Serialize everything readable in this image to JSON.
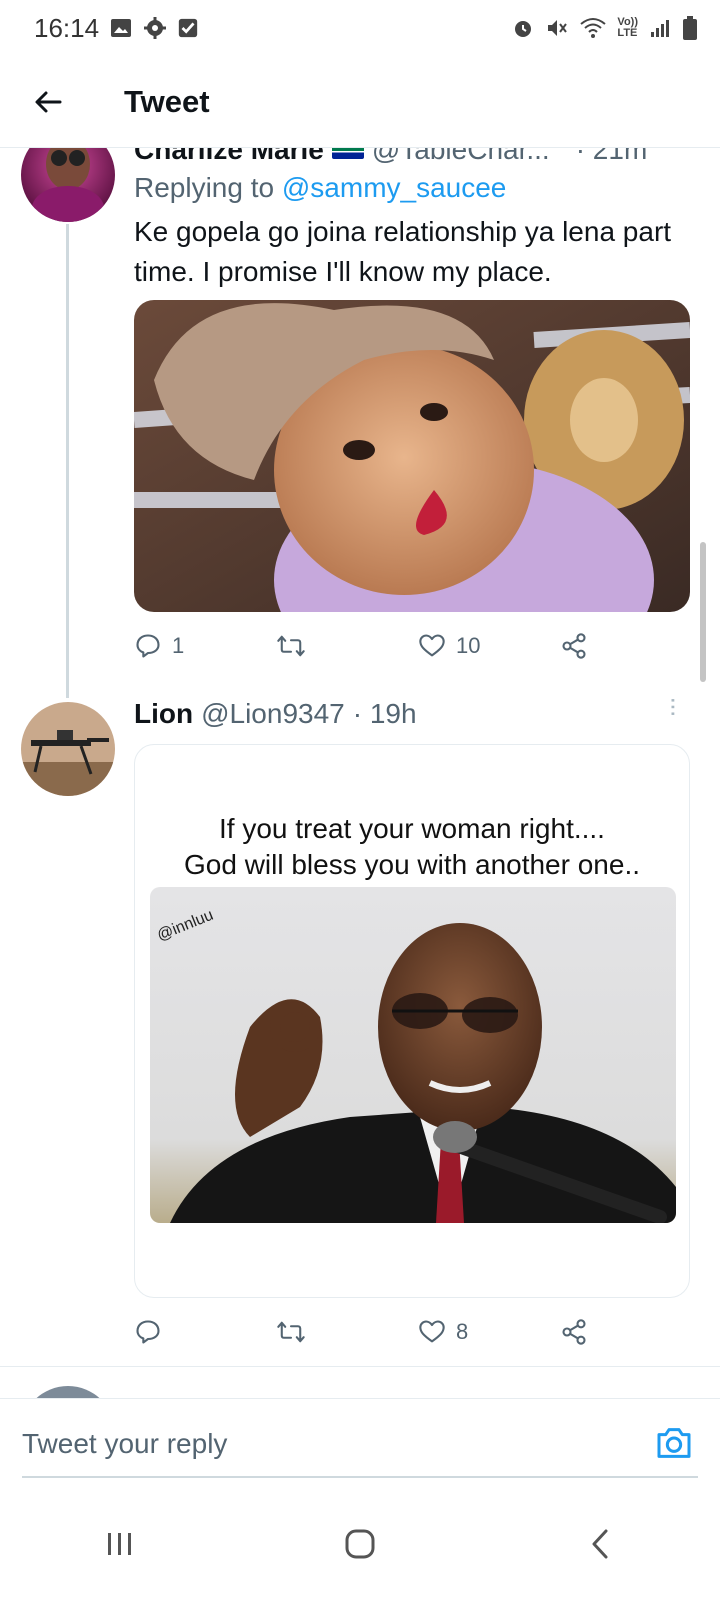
{
  "status_bar": {
    "time": "16:14",
    "left_icons": [
      "gallery-icon",
      "gear-icon",
      "checkbox-icon"
    ],
    "right_icons": [
      "alarm-icon",
      "mute-icon",
      "wifi-icon",
      "volte-icon",
      "signal-icon",
      "battery-icon"
    ],
    "volte_top": "Vo))",
    "volte_bottom": "LTE"
  },
  "header": {
    "title": "Tweet",
    "back_icon": "arrow-left-icon"
  },
  "tweets": [
    {
      "display_name": "Charlize Marie",
      "handle": "@TableChar...",
      "time": "· 21m",
      "replying_prefix": "Replying to",
      "replying_to": "@sammy_saucee",
      "text": "Ke gopela go joina relationship ya lena part time. I promise I'll know my place.",
      "reply_count": "1",
      "retweet_count": "",
      "like_count": "10"
    },
    {
      "display_name": "Lion",
      "handle": "@Lion9347",
      "time": "· 19h",
      "meme_caption_line1": "If you treat your woman right....",
      "meme_caption_line2": "God will bless you with another one..",
      "meme_watermark": "@innluu",
      "reply_count": "",
      "retweet_count": "",
      "like_count": "8"
    }
  ],
  "composer": {
    "placeholder": "Tweet your reply",
    "camera_icon": "camera-icon"
  },
  "nav_bar": {
    "icons": [
      "recent-apps-icon",
      "home-icon",
      "back-icon"
    ]
  },
  "colors": {
    "accent": "#1d9bf0",
    "text_primary": "#0f1419",
    "text_secondary": "#536471",
    "divider": "#e6ecf0"
  }
}
